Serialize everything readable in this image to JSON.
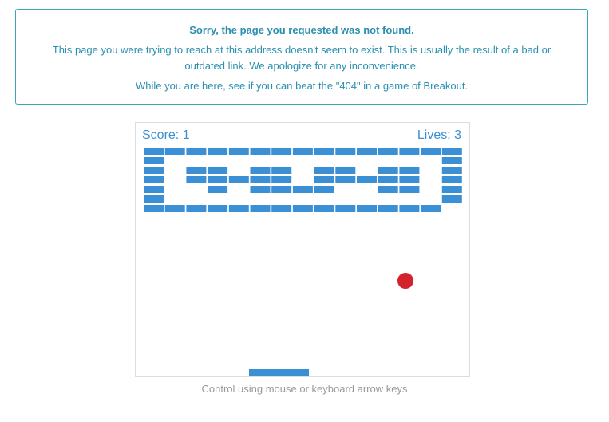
{
  "notice": {
    "title": "Sorry, the page you requested was not found.",
    "body_line1": "This page you were trying to reach at this address doesn't seem to exist. This is usually the result of a bad or outdated link. We apologize for any inconvenience.",
    "body_line2": "While you are here, see if you can beat the \"404\" in a game of Breakout."
  },
  "game": {
    "score_label": "Score: 1",
    "lives_label": "Lives: 3",
    "colors": {
      "brick": "#3b8fd4",
      "ball": "#d4212b",
      "paddle": "#3b8fd4",
      "hud_text": "#3b8fd4"
    },
    "brick_pattern": [
      "111111111111111",
      "100000000000001",
      "101101101101101",
      "101111101111101",
      "100101111001101",
      "100000000000001",
      "111111111111110"
    ]
  },
  "caption": "Control using mouse or keyboard arrow keys"
}
